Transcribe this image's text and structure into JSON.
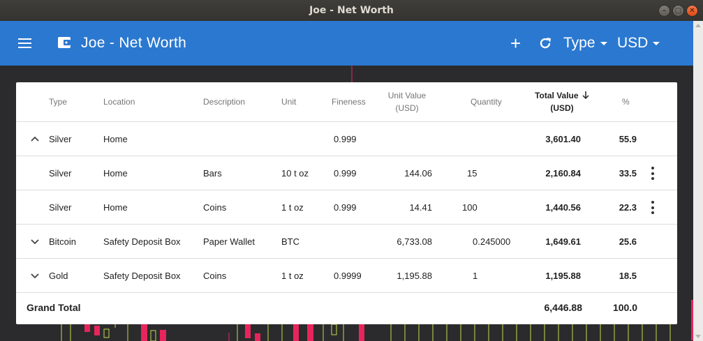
{
  "window": {
    "title": "Joe - Net Worth",
    "buttons": [
      "minimize",
      "maximize",
      "close"
    ]
  },
  "appbar": {
    "title": "Joe - Net Worth",
    "type_label": "Type",
    "currency_label": "USD",
    "color": "#2b78d0"
  },
  "table": {
    "headers": {
      "type": "Type",
      "location": "Location",
      "description": "Description",
      "unit": "Unit",
      "fineness": "Fineness",
      "unit_value_1": "Unit Value",
      "unit_value_2": "(USD)",
      "quantity": "Quantity",
      "total_value_1": "Total Value",
      "total_value_2": "(USD)",
      "percent": "%"
    },
    "rows": [
      {
        "group": true,
        "expanded": true,
        "type": "Silver",
        "location": "Home",
        "description": "",
        "unit": "",
        "fineness": "0.999",
        "unit_value": "",
        "quantity": "",
        "total": "3,601.40",
        "percent": "55.9"
      },
      {
        "group": false,
        "type": "Silver",
        "location": "Home",
        "description": "Bars",
        "unit": "10 t oz",
        "fineness": "0.999",
        "unit_value": "144.06",
        "quantity": "15",
        "total": "2,160.84",
        "percent": "33.5"
      },
      {
        "group": false,
        "type": "Silver",
        "location": "Home",
        "description": "Coins",
        "unit": "1 t oz",
        "fineness": "0.999",
        "unit_value": "14.41",
        "quantity": "100",
        "total": "1,440.56",
        "percent": "22.3"
      },
      {
        "group": true,
        "expanded": false,
        "type": "Bitcoin",
        "location": "Safety Deposit Box",
        "description": "Paper Wallet",
        "unit": "BTC",
        "fineness": "",
        "unit_value": "6,733.08",
        "quantity": "0.245000",
        "total": "1,649.61",
        "percent": "25.6"
      },
      {
        "group": true,
        "expanded": false,
        "type": "Gold",
        "location": "Safety Deposit Box",
        "description": "Coins",
        "unit": "1 t oz",
        "fineness": "0.9999",
        "unit_value": "1,195.88",
        "quantity": "1",
        "total": "1,195.88",
        "percent": "18.5"
      }
    ],
    "grand_total": {
      "label": "Grand Total",
      "total": "6,446.88",
      "percent": "100.0"
    }
  },
  "colors": {
    "up_candle": "#c5d84b",
    "down_candle": "#e8245c",
    "background": "#2b2b2d"
  }
}
